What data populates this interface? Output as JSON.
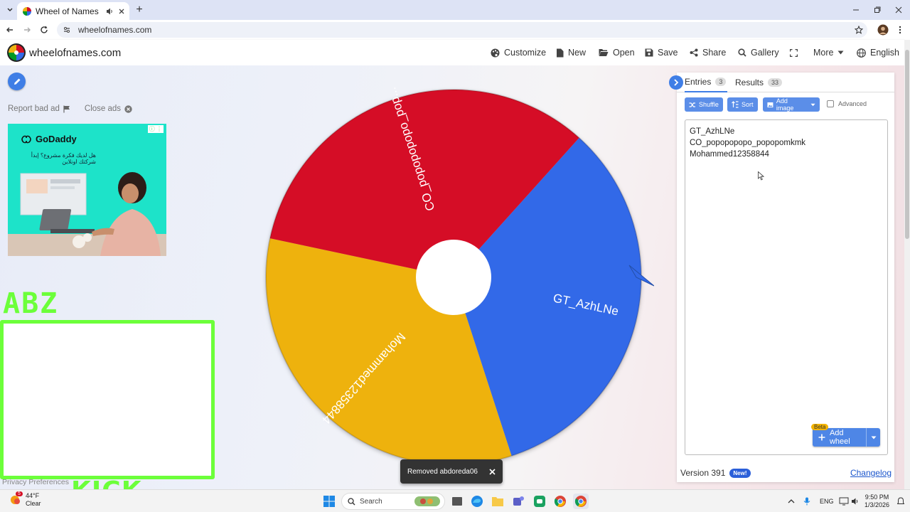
{
  "browser": {
    "tab_title": "Wheel of Names | Random",
    "url": "wheelofnames.com"
  },
  "site": {
    "name": "wheelofnames.com",
    "nav": {
      "customize": "Customize",
      "new": "New",
      "open": "Open",
      "save": "Save",
      "share": "Share",
      "gallery": "Gallery",
      "more": "More",
      "language": "English"
    }
  },
  "left": {
    "report_bad_ad": "Report bad ad",
    "close_ads": "Close ads",
    "ad": {
      "brand": "GoDaddy",
      "text": "هل لديك فكرة مشروع؟ إبدأ شركتك اونلاين"
    },
    "overlay_top": "ABZ",
    "overlay_bottom": "KICK",
    "privacy": "Privacy Preferences"
  },
  "wheel": {
    "slices": [
      {
        "label": "GT_AzhLNe",
        "color": "#3369e8"
      },
      {
        "label": "Mohammed12358844",
        "color": "#eeb211"
      },
      {
        "label": "CO_popopopopo_pop...",
        "color": "#d50f25"
      }
    ],
    "center_color": "#ffffff"
  },
  "panel": {
    "tab_entries": "Entries",
    "entries_count": "3",
    "tab_results": "Results",
    "results_count": "33",
    "shuffle": "Shuffle",
    "sort": "Sort",
    "add_image": "Add image",
    "advanced": "Advanced",
    "entries": [
      "GT_AzhLNe",
      "CO_popopopopo_popopomkmk",
      "Mohammed12358844"
    ],
    "beta": "Beta",
    "add_wheel": "Add wheel",
    "version": "Version 391",
    "new_badge": "New!",
    "changelog": "Changelog"
  },
  "toast": {
    "message": "Removed abdoreda06"
  },
  "taskbar": {
    "temp": "44°F",
    "condition": "Clear",
    "search": "Search",
    "lang": "ENG",
    "time": "9:50 PM",
    "date": "1/3/2026",
    "weather_badge": "5"
  }
}
